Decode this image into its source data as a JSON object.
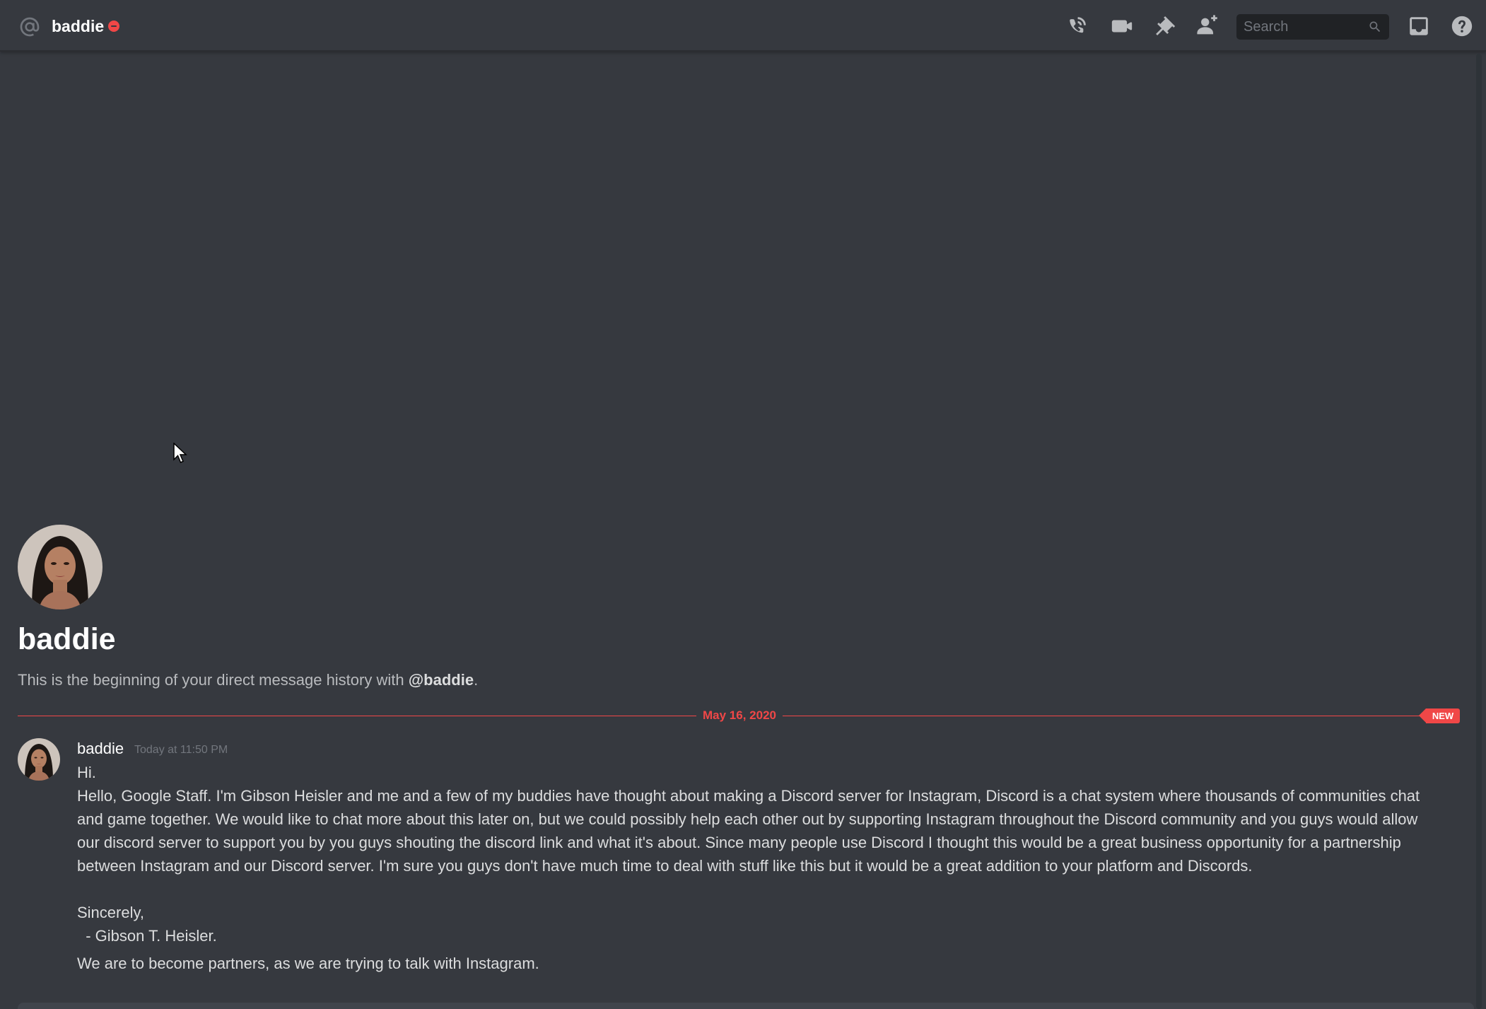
{
  "header": {
    "channel_name": "baddie",
    "status": "do-not-disturb",
    "icons": [
      "at-icon",
      "start-voice-call-icon",
      "start-video-call-icon",
      "pinned-messages-icon",
      "add-friends-to-dm-icon",
      "inbox-icon",
      "help-icon"
    ],
    "search": {
      "placeholder": "Search",
      "value": ""
    }
  },
  "welcome": {
    "title": "baddie",
    "subtitle_prefix": "This is the beginning of your direct message history with ",
    "subtitle_mention": "@baddie",
    "subtitle_suffix": "."
  },
  "divider": {
    "date": "May 16, 2020",
    "badge": "NEW"
  },
  "message": {
    "author": "baddie",
    "timestamp": "Today at 11:50 PM",
    "lines": {
      "greeting": "Hi.",
      "body": "Hello, Google Staff. I'm Gibson Heisler and me and a few of my buddies have thought about making a Discord server for Instagram, Discord is a chat system where thousands of communities chat and game together. We would like to chat more about this later on, but we could possibly help each other out by supporting Instagram throughout the Discord community and you guys would allow our discord server to support you by you guys shouting the discord link and what it's about. Since many people use Discord I thought this would be a great business opportunity for a partnership between Instagram and our Discord server. I'm sure you guys don't have much time to deal with stuff like this but it would be a great addition to your platform and Discords.",
      "signoff": "Sincerely,",
      "signature": "  - Gibson T. Heisler.",
      "followup": "We are to become partners, as we are trying to talk with Instagram."
    }
  },
  "colors": {
    "background": "#36393f",
    "header_text": "#ffffff",
    "muted_text": "#b9bbbe",
    "new_divider": "#f04747",
    "dnd_status": "#f04747",
    "icon": "#b9bbbe",
    "search_bg": "#202225"
  }
}
